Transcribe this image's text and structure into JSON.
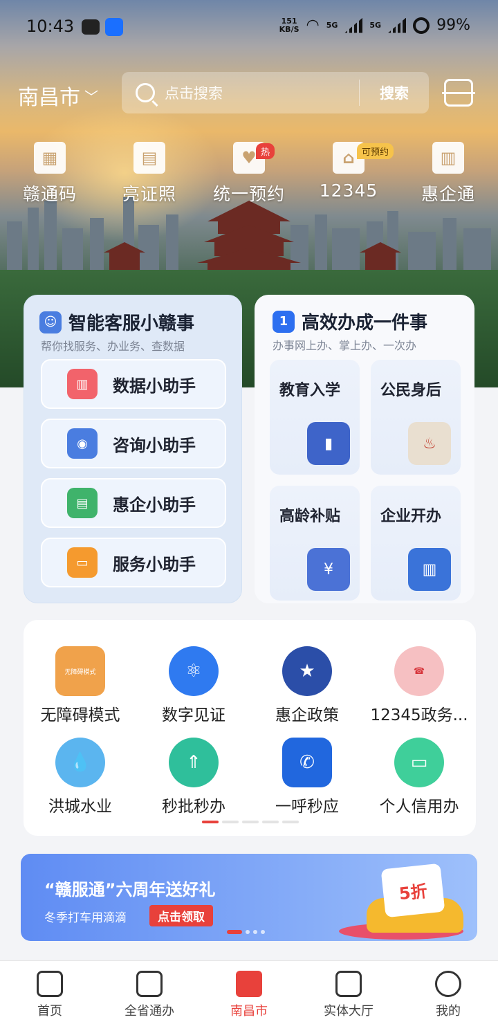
{
  "status_bar": {
    "time": "10:43",
    "net_speed_value": "151",
    "net_speed_unit": "KB/S",
    "signal1": "5G",
    "signal2": "5G",
    "battery": "99%"
  },
  "header": {
    "city": "南昌市",
    "search_placeholder": "点击搜索",
    "search_button": "搜索"
  },
  "quick_actions": [
    {
      "label": "赣通码",
      "icon": "qr-grid-icon"
    },
    {
      "label": "亮证照",
      "icon": "id-card-icon"
    },
    {
      "label": "统一预约",
      "icon": "heart-hands-icon",
      "tag": "热"
    },
    {
      "label": "12345",
      "icon": "government-building-icon",
      "tag": "可预约"
    },
    {
      "label": "惠企通",
      "icon": "office-building-icon"
    }
  ],
  "assistant_card": {
    "title": "智能客服小赣事",
    "subtitle": "帮你找服务、办业务、查数据",
    "items": [
      {
        "label": "数据小助手",
        "color": "#f2636b"
      },
      {
        "label": "咨询小助手",
        "color": "#4a7de0"
      },
      {
        "label": "惠企小助手",
        "color": "#3fb36b"
      },
      {
        "label": "服务小助手",
        "color": "#f59a2e"
      }
    ]
  },
  "one_thing_card": {
    "title": "高效办成一件事",
    "subtitle": "办事网上办、掌上办、一次办",
    "tiles": [
      {
        "label": "教育入学",
        "icon": "graduation-book-icon"
      },
      {
        "label": "公民身后",
        "icon": "candle-icon"
      },
      {
        "label": "高龄补贴",
        "icon": "money-bag-icon"
      },
      {
        "label": "企业开办",
        "icon": "city-buildings-icon"
      }
    ]
  },
  "services": [
    {
      "label": "无障碍模式",
      "color": "#f0a24b",
      "icon": "accessibility-icon",
      "badge": "无障碍模式"
    },
    {
      "label": "数字见证",
      "color": "#2f7af0",
      "icon": "atom-icon"
    },
    {
      "label": "惠企政策",
      "color": "#2b4ea8",
      "icon": "star-building-icon"
    },
    {
      "label": "12345政务...",
      "color": "#f6c0c2",
      "icon": "hotline-12345-icon"
    },
    {
      "label": "洪城水业",
      "color": "#5bb5ef",
      "icon": "water-drop-icon"
    },
    {
      "label": "秒批秒办",
      "color": "#2fbf9b",
      "icon": "approve-fast-icon"
    },
    {
      "label": "一呼秒应",
      "color": "#2167de",
      "icon": "call-response-icon"
    },
    {
      "label": "个人信用办",
      "color": "#3fcf9a",
      "icon": "credit-card-icon"
    }
  ],
  "banner": {
    "title": "“赣服通”六周年送好礼",
    "subtitle": "冬季打车用滴滴",
    "button": "点击领取",
    "discount": "5折"
  },
  "bottom_nav": [
    {
      "label": "首页",
      "icon": "home-icon"
    },
    {
      "label": "全省通办",
      "icon": "document-icon"
    },
    {
      "label": "南昌市",
      "icon": "city-gate-icon",
      "active": true
    },
    {
      "label": "实体大厅",
      "icon": "hall-icon"
    },
    {
      "label": "我的",
      "icon": "profile-icon"
    }
  ]
}
